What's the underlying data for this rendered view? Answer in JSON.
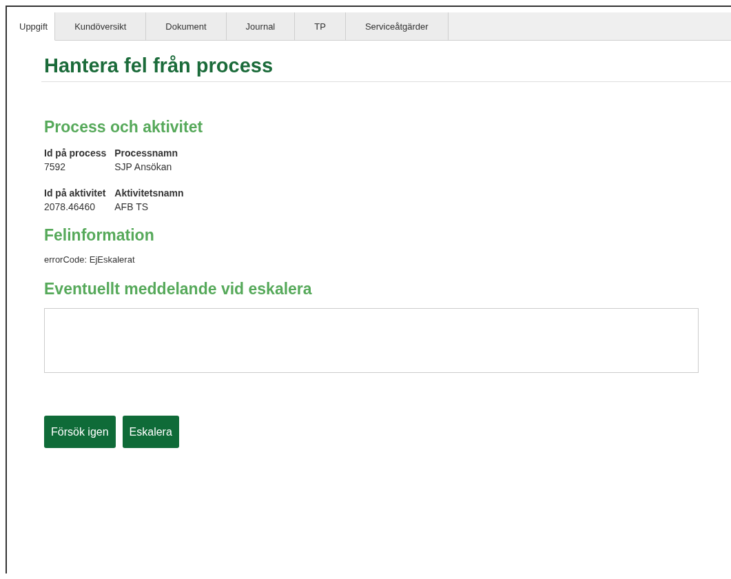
{
  "tabs": [
    {
      "label": "Uppgift",
      "selected": true
    },
    {
      "label": "Kundöversikt",
      "selected": false
    },
    {
      "label": "Dokument",
      "selected": false
    },
    {
      "label": "Journal",
      "selected": false
    },
    {
      "label": "TP",
      "selected": false
    },
    {
      "label": "Serviceåtgärder",
      "selected": false
    }
  ],
  "page_title": "Hantera fel från process",
  "process_section": {
    "heading": "Process och aktivitet",
    "groups": [
      {
        "fields": [
          {
            "label": "Id på process",
            "value": "7592"
          },
          {
            "label": "Processnamn",
            "value": "SJP Ansökan"
          }
        ]
      },
      {
        "fields": [
          {
            "label": "Id på aktivitet",
            "value": "2078.46460"
          },
          {
            "label": "Aktivitetsnamn",
            "value": "AFB TS"
          }
        ]
      }
    ]
  },
  "error_section": {
    "heading": "Felinformation",
    "text": "errorCode: EjEskalerat"
  },
  "message_section": {
    "heading": "Eventuellt meddelande vid eskalera"
  },
  "buttons": [
    "Försök igen",
    "Eskalera"
  ]
}
